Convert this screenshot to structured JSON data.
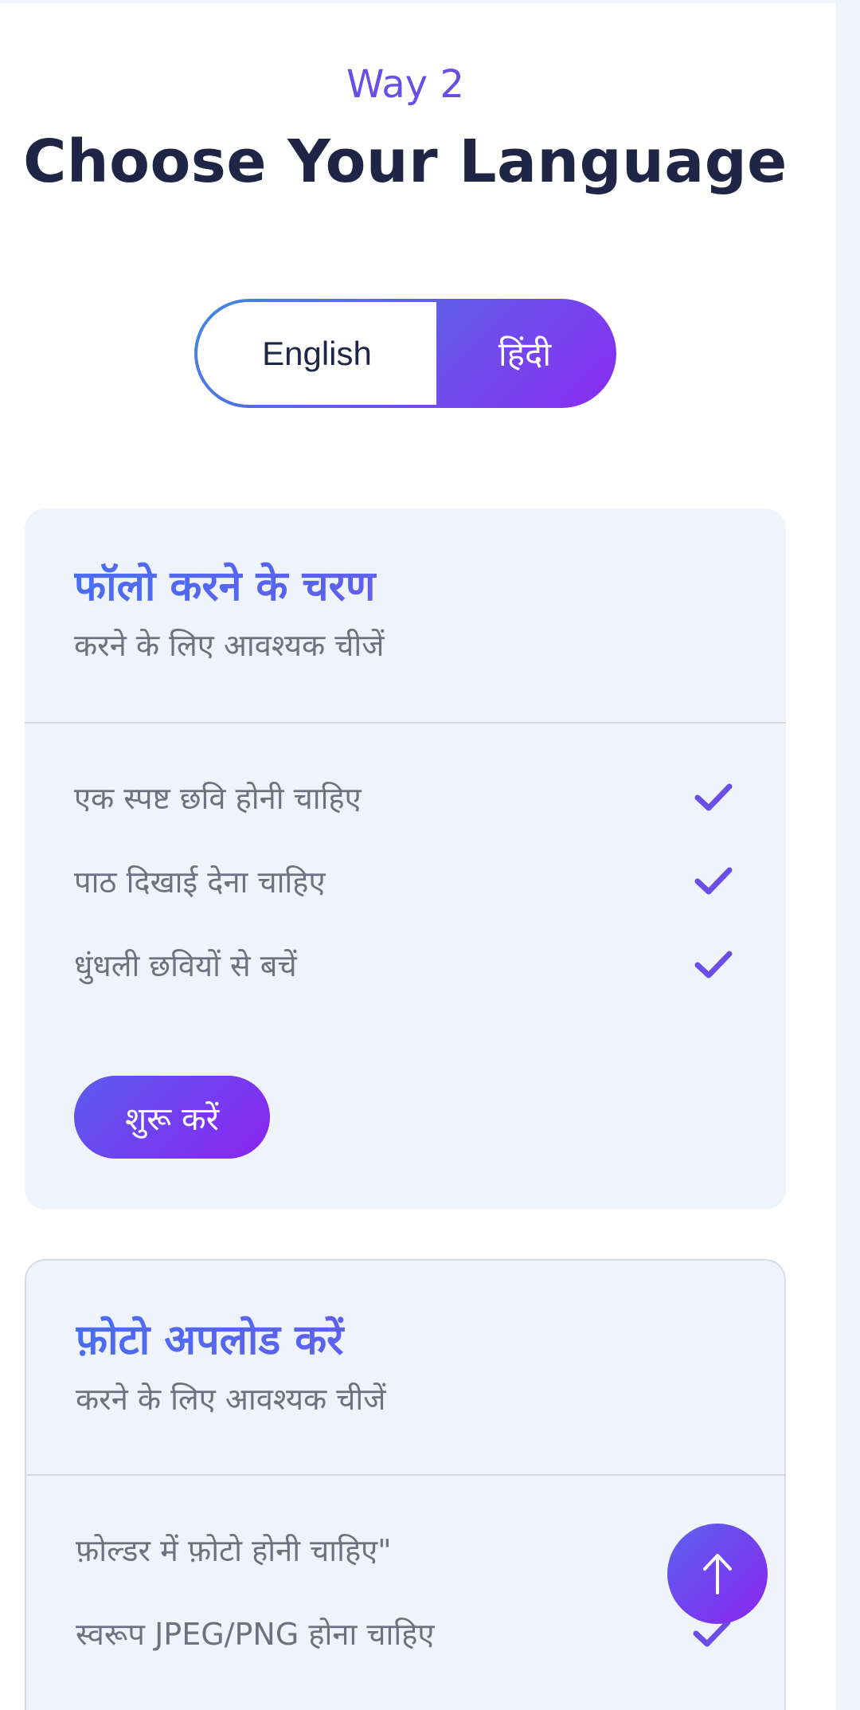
{
  "header": {
    "eyebrow": "Way 2",
    "title": "Choose Your Language"
  },
  "language_toggle": {
    "options": [
      "English",
      "हिंदी"
    ],
    "selected": "हिंदी"
  },
  "cards": [
    {
      "title": "फॉलो करने के चरण",
      "subtitle": "करने के लिए आवश्यक चीजें",
      "items": [
        {
          "text": "एक स्पष्ट छवि होनी चाहिए",
          "icon": "check-icon"
        },
        {
          "text": "पाठ दिखाई देना चाहिए",
          "icon": "check-icon"
        },
        {
          "text": "धुंधली छवियों से बचें",
          "icon": "check-icon"
        }
      ],
      "button_label": "शुरू करें"
    },
    {
      "title": "फ़ोटो अपलोड करें",
      "subtitle": "करने के लिए आवश्यक चीजें",
      "items": [
        {
          "text": "फ़ोल्डर में फ़ोटो होनी चाहिए\"",
          "icon": "check-icon"
        },
        {
          "text": "स्वरूप JPEG/PNG होना चाहिए",
          "icon": "check-icon"
        }
      ]
    }
  ],
  "fab": {
    "icon": "arrow-up-icon"
  },
  "colors": {
    "accent": "#6a4ee6",
    "gradient_start": "#3f8ae0",
    "gradient_end": "#8a2bf2",
    "card_bg": "#eef3fc",
    "title_text": "#1f2544"
  }
}
